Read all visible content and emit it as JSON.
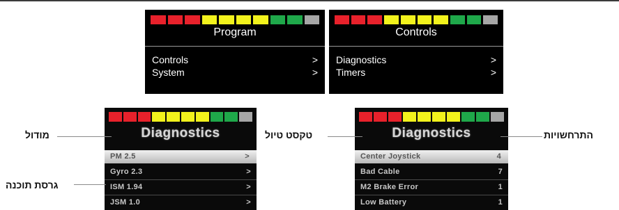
{
  "colors": {
    "red": "#e8212b",
    "yellow": "#f2f21c",
    "green": "#1fa84a",
    "gray": "#a6a6a6"
  },
  "battery_segments": [
    "red",
    "red",
    "red",
    "yellow",
    "yellow",
    "yellow",
    "yellow",
    "green",
    "green",
    "gray"
  ],
  "screens": {
    "program": {
      "title": "Program",
      "items": [
        {
          "label": "Controls",
          "arrow": ">"
        },
        {
          "label": "System",
          "arrow": ">"
        }
      ]
    },
    "controls": {
      "title": "Controls",
      "items": [
        {
          "label": "Diagnostics",
          "arrow": ">"
        },
        {
          "label": "Timers",
          "arrow": ">"
        }
      ]
    },
    "diag_modules": {
      "title": "Diagnostics",
      "items": [
        {
          "label": "PM 2.5",
          "value": ">"
        },
        {
          "label": "Gyro 2.3",
          "value": ">"
        },
        {
          "label": "ISM 1.94",
          "value": ">"
        },
        {
          "label": "JSM 1.0",
          "value": ">"
        }
      ]
    },
    "diag_events": {
      "title": "Diagnostics",
      "items": [
        {
          "label": "Center Joystick",
          "value": "4"
        },
        {
          "label": "Bad Cable",
          "value": "7"
        },
        {
          "label": "M2 Brake Error",
          "value": "1"
        },
        {
          "label": "Low Battery",
          "value": "1"
        }
      ]
    }
  },
  "annotations": {
    "module": "מודול",
    "software_version": "גרסת תוכנה",
    "error_text": "טקסט טיול",
    "occurrences": "התרחשויות"
  }
}
